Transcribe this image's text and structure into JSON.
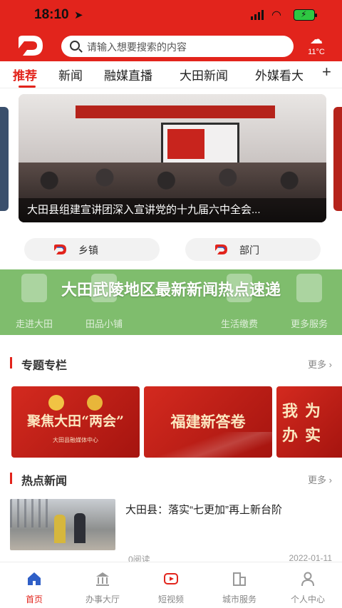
{
  "status_bar": {
    "time": "18:10",
    "battery_text": "⚡"
  },
  "header": {
    "search_placeholder": "请输入想要搜索的内容",
    "weather_temp": "11°C",
    "colors": {
      "brand_red": "#e2241c"
    }
  },
  "tabs": {
    "items": [
      {
        "label": "推荐",
        "active": true
      },
      {
        "label": "新闻",
        "active": false
      },
      {
        "label": "融媒直播",
        "active": false
      },
      {
        "label": "大田新闻",
        "active": false
      },
      {
        "label": "外媒看大",
        "active": false
      }
    ],
    "add_label": "+"
  },
  "banner": {
    "caption": "大田县组建宣讲团深入宣讲党的十九届六中全会..."
  },
  "quick_links": [
    {
      "label": "乡镇"
    },
    {
      "label": "部门"
    }
  ],
  "services": [
    {
      "label": "走进大田"
    },
    {
      "label": "田品小铺"
    },
    {
      "label": "生活缴费"
    },
    {
      "label": "更多服务"
    }
  ],
  "overlay_title": "大田武陵地区最新新闻热点速递",
  "topics_section": {
    "title": "专题专栏",
    "more": "更多 ›",
    "cards": [
      {
        "title": "聚焦大田“两会”",
        "sub": "大田县融媒体中心"
      },
      {
        "title": "福建新答卷",
        "sub": ""
      },
      {
        "title": "我为办实",
        "sub": ""
      }
    ]
  },
  "hot_news_section": {
    "title": "热点新闻",
    "more": "更多 ›",
    "items": [
      {
        "title": "大田县：落实“七更加”再上新台阶",
        "reads": "0阅读",
        "date": "2022-01-11"
      }
    ]
  },
  "bottom_nav": [
    {
      "label": "首页",
      "icon": "home-icon",
      "active": true
    },
    {
      "label": "办事大厅",
      "icon": "hall-icon",
      "active": false
    },
    {
      "label": "短视频",
      "icon": "video-icon",
      "active": false
    },
    {
      "label": "城市服务",
      "icon": "city-icon",
      "active": false
    },
    {
      "label": "个人中心",
      "icon": "person-icon",
      "active": false
    }
  ]
}
